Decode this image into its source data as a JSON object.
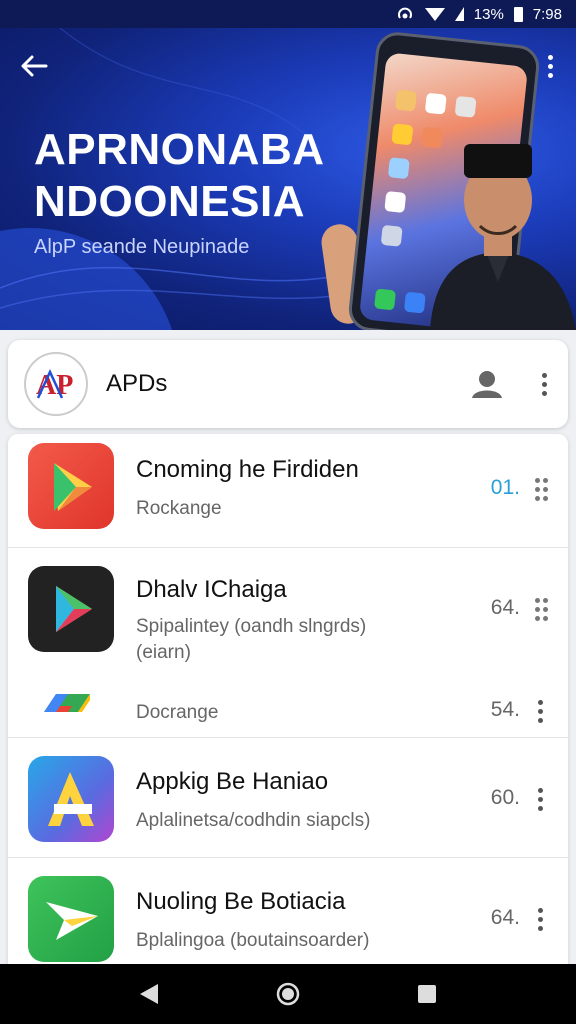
{
  "status_bar": {
    "battery": "13%",
    "time": "7:98"
  },
  "hero": {
    "title_line1": "APRNONABA",
    "title_line2": "NDOONESIA",
    "subtitle": "AlpP seande Neupinade"
  },
  "app_header": {
    "name": "APDs",
    "logo_text": "AP"
  },
  "apps": [
    {
      "title": "Cnoming he Firdiden",
      "subtitle": "Rockange",
      "value": "01.",
      "value_color": "#2a9fd6"
    },
    {
      "title": "Dhalv IChaiga",
      "subtitle": "Spipalintey (oandh slngrds)",
      "subtitle2": "(eiarn)",
      "value": "64."
    },
    {
      "title": "",
      "subtitle": "Docrange",
      "value": "54."
    },
    {
      "title": "Appkig Be Haniao",
      "subtitle": "Aplalinetsa/codhdin siapcls)",
      "value": "60."
    },
    {
      "title": "Nuoling Be Botiacia",
      "subtitle": "Bplalingoa (boutainsoarder)",
      "value": "64."
    }
  ],
  "icons": {
    "back": "arrow-left-icon",
    "more": "more-vertical-icon",
    "user": "user-icon",
    "nav_back": "triangle-back-icon",
    "nav_home": "circle-home-icon",
    "nav_recent": "square-recent-icon"
  }
}
